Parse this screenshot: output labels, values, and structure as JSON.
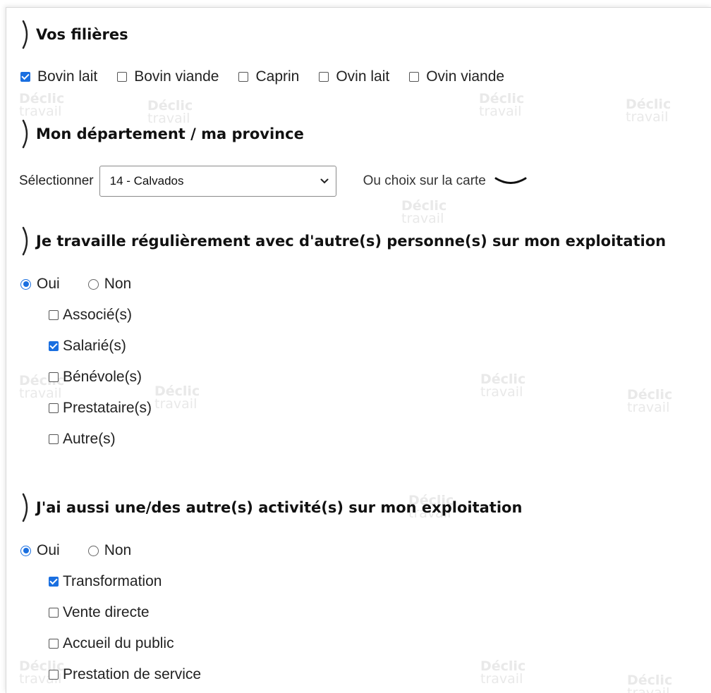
{
  "watermark": {
    "line1": "Déclic",
    "line2": "travail"
  },
  "section_filieres": {
    "title": "Vos filières",
    "options": [
      {
        "label": "Bovin lait",
        "checked": true
      },
      {
        "label": "Bovin viande",
        "checked": false
      },
      {
        "label": "Caprin",
        "checked": false
      },
      {
        "label": "Ovin lait",
        "checked": false
      },
      {
        "label": "Ovin viande",
        "checked": false
      }
    ]
  },
  "section_departement": {
    "title": "Mon département / ma province",
    "select_label": "Sélectionner",
    "selected_value": "14 - Calvados",
    "map_link": "Ou choix sur la carte"
  },
  "section_travail": {
    "title": "Je travaille régulièrement avec d'autre(s) personne(s) sur mon exploitation",
    "radio_yes": "Oui",
    "radio_no": "Non",
    "selected": "Oui",
    "options": [
      {
        "label": "Associé(s)",
        "checked": false
      },
      {
        "label": "Salarié(s)",
        "checked": true
      },
      {
        "label": "Bénévole(s)",
        "checked": false
      },
      {
        "label": "Prestataire(s)",
        "checked": false
      },
      {
        "label": "Autre(s)",
        "checked": false
      }
    ]
  },
  "section_activites": {
    "title": "J'ai aussi une/des autre(s) activité(s) sur mon exploitation",
    "radio_yes": "Oui",
    "radio_no": "Non",
    "selected": "Oui",
    "options": [
      {
        "label": "Transformation",
        "checked": true
      },
      {
        "label": "Vente directe",
        "checked": false
      },
      {
        "label": "Accueil du public",
        "checked": false
      },
      {
        "label": "Prestation de service",
        "checked": false
      }
    ]
  },
  "colors": {
    "accent": "#1a6fe0",
    "text": "#1a1a1a",
    "watermark": "#e9e9e9"
  }
}
